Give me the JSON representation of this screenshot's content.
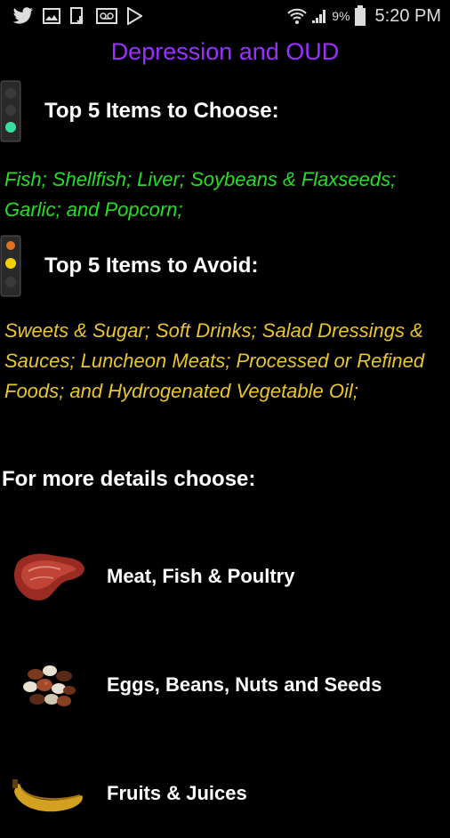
{
  "status_bar": {
    "icons_left": [
      "twitter-icon",
      "image-icon",
      "download-icon",
      "voicemail-icon",
      "play-store-icon"
    ],
    "icons_right": [
      "wifi-icon",
      "signal-icon"
    ],
    "battery": "9%",
    "time": "5:20 PM"
  },
  "app": {
    "title": "Depression and OUD"
  },
  "choose": {
    "heading": "Top 5 Items to Choose:",
    "text": "Fish; Shellfish; Liver; Soybeans & Flaxseeds; Garlic; and Popcorn;",
    "color": "#22e022"
  },
  "avoid": {
    "heading": "Top 5 Items to Avoid:",
    "text": "Sweets & Sugar; Soft Drinks; Salad Dressings & Sauces; Luncheon Meats; Processed or Refined Foods; and Hydrogenated Vegetable Oil;",
    "color": "#e9c62c"
  },
  "details": {
    "prompt": "For more details choose:",
    "categories": [
      {
        "label": "Meat, Fish & Poultry",
        "icon": "steak-icon"
      },
      {
        "label": "Eggs, Beans, Nuts and Seeds",
        "icon": "beans-icon"
      },
      {
        "label": "Fruits & Juices",
        "icon": "banana-icon"
      }
    ]
  },
  "colors": {
    "title": "#9b30ff",
    "background": "#000000"
  }
}
